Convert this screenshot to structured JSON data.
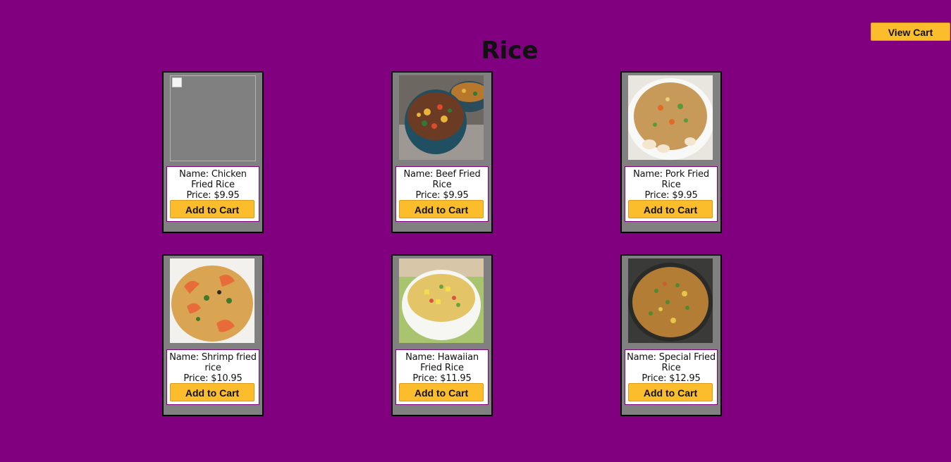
{
  "header": {
    "view_cart_label": "View Cart",
    "title": "Rice"
  },
  "products": [
    {
      "name_prefix": "Name:",
      "name": "Chicken Fried Rice",
      "price_prefix": "Price:",
      "price": "$9.95",
      "button_label": "Add to Cart",
      "image": "broken-image",
      "image_accent": "#808080"
    },
    {
      "name_prefix": "Name:",
      "name": "Beef Fried Rice",
      "price_prefix": "Price:",
      "price": "$9.95",
      "button_label": "Add to Cart",
      "image": "beef-fried-rice-photo",
      "image_accent": "#5a4a3f"
    },
    {
      "name_prefix": "Name:",
      "name": "Pork Fried Rice",
      "price_prefix": "Price:",
      "price": "$9.95",
      "button_label": "Add to Cart",
      "image": "pork-fried-rice-photo",
      "image_accent": "#c9a060"
    },
    {
      "name_prefix": "Name:",
      "name": "Shrimp fried rice",
      "price_prefix": "Price:",
      "price": "$10.95",
      "button_label": "Add to Cart",
      "image": "shrimp-fried-rice-photo",
      "image_accent": "#c98a3c"
    },
    {
      "name_prefix": "Name:",
      "name": "Hawaiian Fried Rice",
      "price_prefix": "Price:",
      "price": "$11.95",
      "button_label": "Add to Cart",
      "image": "hawaiian-fried-rice-photo",
      "image_accent": "#d8b05a"
    },
    {
      "name_prefix": "Name:",
      "name": "Special Fried Rice",
      "price_prefix": "Price:",
      "price": "$12.95",
      "button_label": "Add to Cart",
      "image": "special-fried-rice-photo",
      "image_accent": "#b07a32"
    }
  ],
  "colors": {
    "background": "#800080",
    "card": "#808080",
    "button": "#fbbd2b"
  }
}
